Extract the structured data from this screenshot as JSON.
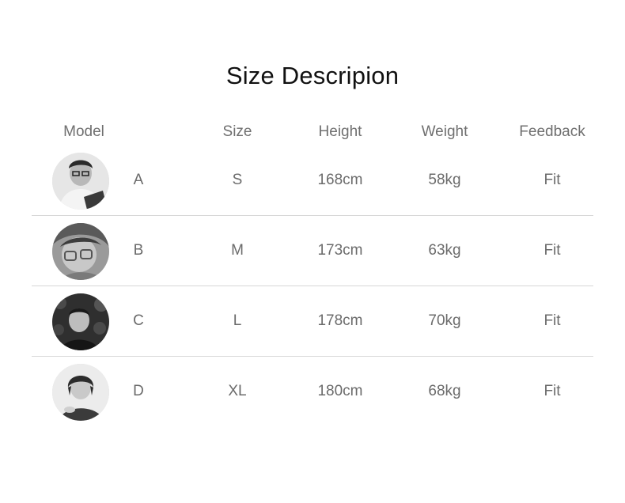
{
  "title": "Size Descripion",
  "headers": {
    "model": "Model",
    "size": "Size",
    "height": "Height",
    "weight": "Weight",
    "feedback": "Feedback"
  },
  "rows": [
    {
      "model": "A",
      "size": "S",
      "height": "168cm",
      "weight": "58kg",
      "feedback": "Fit",
      "avatar": "model-a-portrait-icon"
    },
    {
      "model": "B",
      "size": "M",
      "height": "173cm",
      "weight": "63kg",
      "feedback": "Fit",
      "avatar": "model-b-portrait-icon"
    },
    {
      "model": "C",
      "size": "L",
      "height": "178cm",
      "weight": "70kg",
      "feedback": "Fit",
      "avatar": "model-c-portrait-icon"
    },
    {
      "model": "D",
      "size": "XL",
      "height": "180cm",
      "weight": "68kg",
      "feedback": "Fit",
      "avatar": "model-d-portrait-icon"
    }
  ],
  "colors": {
    "title": "#111111",
    "text": "#6b6b6b",
    "divider": "#d7d7d7"
  }
}
